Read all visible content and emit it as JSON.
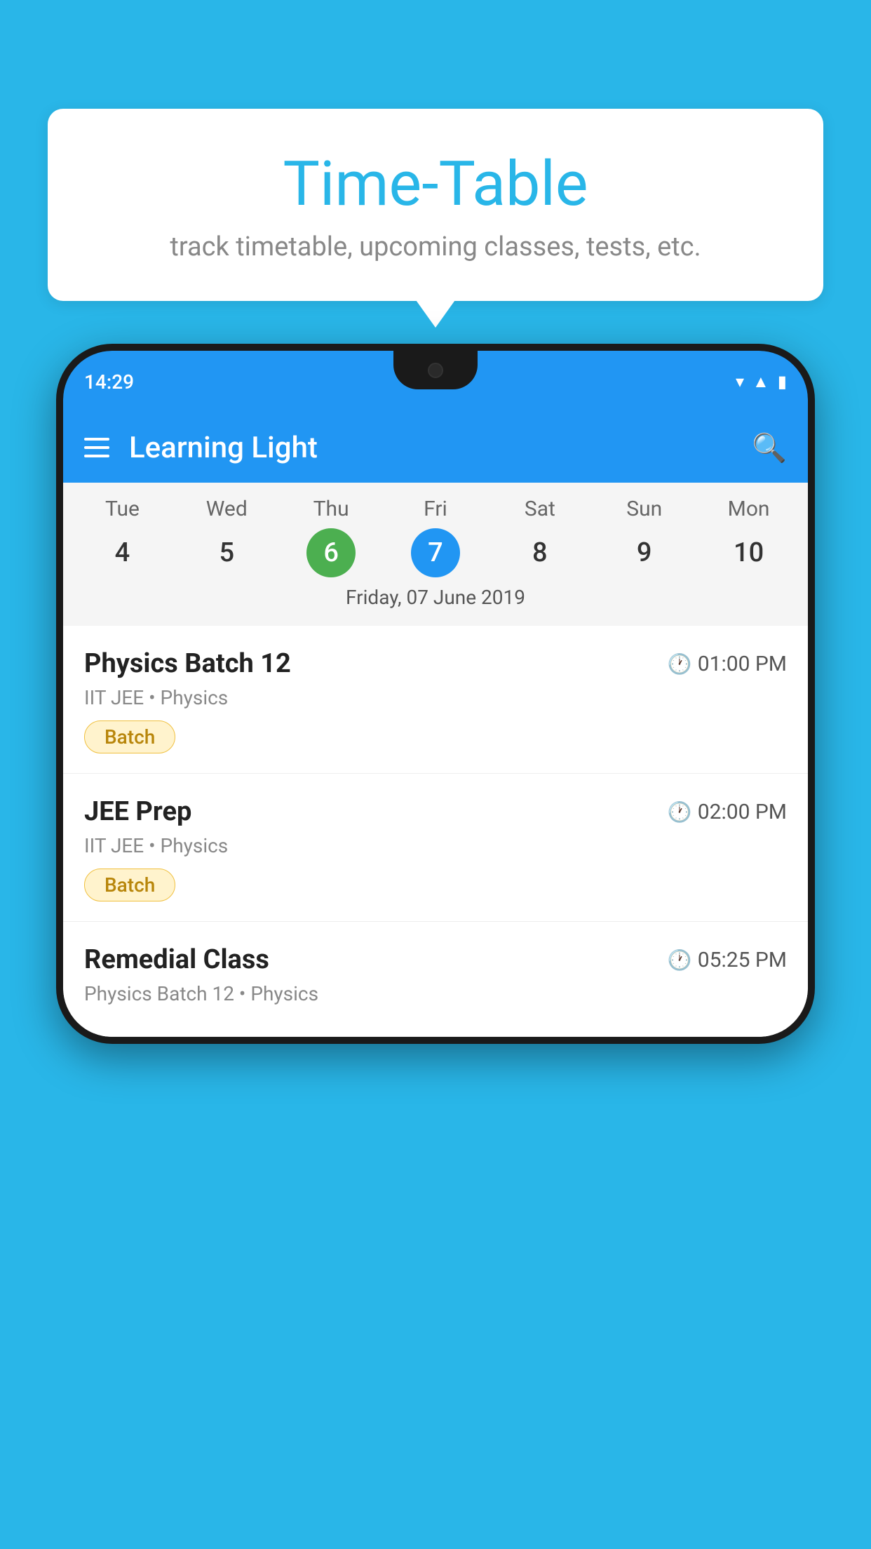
{
  "background_color": "#29b6e8",
  "speech_bubble": {
    "title": "Time-Table",
    "subtitle": "track timetable, upcoming classes, tests, etc."
  },
  "phone": {
    "status_bar": {
      "time": "14:29"
    },
    "app_header": {
      "title": "Learning Light"
    },
    "calendar": {
      "days": [
        "Tue",
        "Wed",
        "Thu",
        "Fri",
        "Sat",
        "Sun",
        "Mon"
      ],
      "dates": [
        "4",
        "5",
        "6",
        "7",
        "8",
        "9",
        "10"
      ],
      "today_index": 2,
      "selected_index": 3,
      "selected_date_label": "Friday, 07 June 2019"
    },
    "schedule_items": [
      {
        "title": "Physics Batch 12",
        "time": "01:00 PM",
        "sub": "IIT JEE • Physics",
        "badge": "Batch"
      },
      {
        "title": "JEE Prep",
        "time": "02:00 PM",
        "sub": "IIT JEE • Physics",
        "badge": "Batch"
      },
      {
        "title": "Remedial Class",
        "time": "05:25 PM",
        "sub": "Physics Batch 12 • Physics",
        "badge": null
      }
    ]
  }
}
